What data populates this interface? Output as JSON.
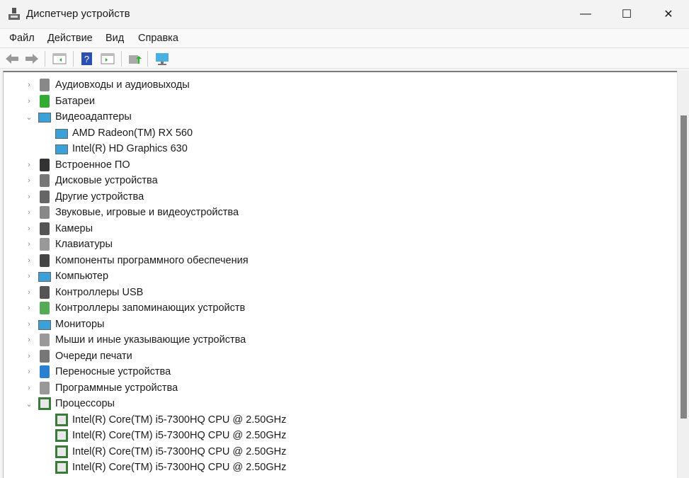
{
  "window": {
    "title": "Диспетчер устройств",
    "minimize": "—",
    "maximize": "☐",
    "close": "✕"
  },
  "menu": [
    "Файл",
    "Действие",
    "Вид",
    "Справка"
  ],
  "toolbar": [
    "back-icon",
    "forward-icon",
    "show-hide-console-tree-icon",
    "help-icon",
    "action-pane-icon",
    "update-driver-icon",
    "scan-hardware-icon"
  ],
  "tree": [
    {
      "label": "Аудиовходы и аудиовыходы",
      "level": 0,
      "state": "collapsed",
      "icon": "speaker-icon"
    },
    {
      "label": "Батареи",
      "level": 0,
      "state": "collapsed",
      "icon": "battery-icon"
    },
    {
      "label": "Видеоадаптеры",
      "level": 0,
      "state": "expanded",
      "icon": "display-adapter-icon"
    },
    {
      "label": "AMD Radeon(TM) RX 560",
      "level": 1,
      "state": "none",
      "icon": "display-adapter-icon"
    },
    {
      "label": "Intel(R) HD Graphics 630",
      "level": 1,
      "state": "none",
      "icon": "display-adapter-icon"
    },
    {
      "label": "Встроенное ПО",
      "level": 0,
      "state": "collapsed",
      "icon": "firmware-icon"
    },
    {
      "label": "Дисковые устройства",
      "level": 0,
      "state": "collapsed",
      "icon": "disk-icon"
    },
    {
      "label": "Другие устройства",
      "level": 0,
      "state": "collapsed",
      "icon": "unknown-device-icon"
    },
    {
      "label": "Звуковые, игровые и видеоустройства",
      "level": 0,
      "state": "collapsed",
      "icon": "speaker-icon"
    },
    {
      "label": "Камеры",
      "level": 0,
      "state": "collapsed",
      "icon": "camera-icon"
    },
    {
      "label": "Клавиатуры",
      "level": 0,
      "state": "collapsed",
      "icon": "keyboard-icon"
    },
    {
      "label": "Компоненты программного обеспечения",
      "level": 0,
      "state": "collapsed",
      "icon": "software-component-icon"
    },
    {
      "label": "Компьютер",
      "level": 0,
      "state": "collapsed",
      "icon": "computer-icon"
    },
    {
      "label": "Контроллеры USB",
      "level": 0,
      "state": "collapsed",
      "icon": "usb-icon"
    },
    {
      "label": "Контроллеры запоминающих устройств",
      "level": 0,
      "state": "collapsed",
      "icon": "storage-controller-icon"
    },
    {
      "label": "Мониторы",
      "level": 0,
      "state": "collapsed",
      "icon": "monitor-icon"
    },
    {
      "label": "Мыши и иные указывающие устройства",
      "level": 0,
      "state": "collapsed",
      "icon": "mouse-icon"
    },
    {
      "label": "Очереди печати",
      "level": 0,
      "state": "collapsed",
      "icon": "printer-icon"
    },
    {
      "label": "Переносные устройства",
      "level": 0,
      "state": "collapsed",
      "icon": "portable-device-icon"
    },
    {
      "label": "Программные устройства",
      "level": 0,
      "state": "collapsed",
      "icon": "software-device-icon"
    },
    {
      "label": "Процессоры",
      "level": 0,
      "state": "expanded",
      "icon": "processor-icon"
    },
    {
      "label": "Intel(R) Core(TM) i5-7300HQ CPU @ 2.50GHz",
      "level": 1,
      "state": "none",
      "icon": "processor-icon"
    },
    {
      "label": "Intel(R) Core(TM) i5-7300HQ CPU @ 2.50GHz",
      "level": 1,
      "state": "none",
      "icon": "processor-icon"
    },
    {
      "label": "Intel(R) Core(TM) i5-7300HQ CPU @ 2.50GHz",
      "level": 1,
      "state": "none",
      "icon": "processor-icon"
    },
    {
      "label": "Intel(R) Core(TM) i5-7300HQ CPU @ 2.50GHz",
      "level": 1,
      "state": "none",
      "icon": "processor-icon"
    }
  ]
}
